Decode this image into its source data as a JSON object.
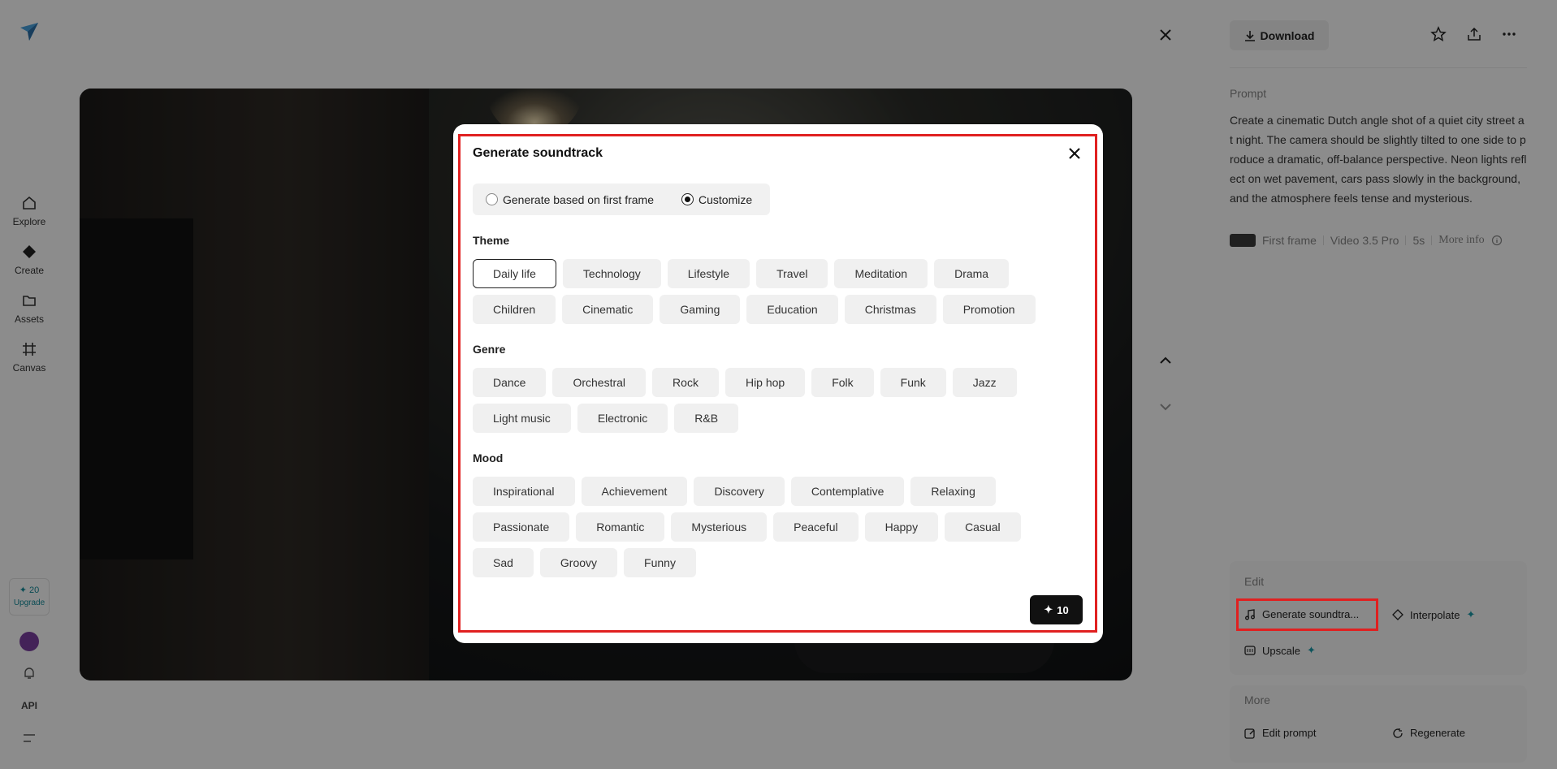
{
  "left_nav": {
    "items": [
      {
        "label": "Explore",
        "icon": "home-icon"
      },
      {
        "label": "Create",
        "icon": "diamond-icon"
      },
      {
        "label": "Assets",
        "icon": "folder-icon"
      },
      {
        "label": "Canvas",
        "icon": "canvas-icon"
      }
    ],
    "credits": "✦ 20",
    "upgrade_label": "Upgrade",
    "api_label": "API"
  },
  "right_panel": {
    "download_label": "Download",
    "prompt_label": "Prompt",
    "prompt_text": "Create a cinematic Dutch angle shot of a quiet city street at night. The camera should be slightly tilted to one side to produce a dramatic, off-balance perspective. Neon lights reflect on wet pavement, cars pass slowly in the background, and the atmosphere feels tense and mysterious.",
    "meta": {
      "first_frame": "First frame",
      "model": "Video 3.5 Pro",
      "duration": "5s",
      "more_info": "More info"
    },
    "edit_label": "Edit",
    "edit_actions": {
      "generate_soundtrack": "Generate soundtra...",
      "interpolate": "Interpolate",
      "upscale": "Upscale"
    },
    "more_label": "More",
    "more_actions": {
      "edit_prompt": "Edit prompt",
      "regenerate": "Regenerate"
    }
  },
  "modal": {
    "title": "Generate soundtrack",
    "modes": {
      "first_frame": "Generate based on first frame",
      "customize": "Customize",
      "selected": "Customize"
    },
    "theme_label": "Theme",
    "theme_row1": [
      "Daily life",
      "Technology",
      "Lifestyle",
      "Travel",
      "Meditation",
      "Drama"
    ],
    "theme_row2": [
      "Children",
      "Cinematic",
      "Gaming",
      "Education",
      "Christmas",
      "Promotion"
    ],
    "selected_theme": "Daily life",
    "genre_label": "Genre",
    "genre_row1": [
      "Dance",
      "Orchestral",
      "Rock",
      "Hip hop",
      "Folk",
      "Funk",
      "Jazz"
    ],
    "genre_row2": [
      "Light music",
      "Electronic",
      "R&B"
    ],
    "mood_label": "Mood",
    "mood_row1": [
      "Inspirational",
      "Achievement",
      "Discovery",
      "Contemplative",
      "Relaxing"
    ],
    "mood_row2": [
      "Passionate",
      "Romantic",
      "Mysterious",
      "Peaceful",
      "Happy",
      "Casual"
    ],
    "mood_row3": [
      "Sad",
      "Groovy",
      "Funny"
    ],
    "generate_cost": "10"
  },
  "colors": {
    "accent": "#1a9aa8",
    "highlight": "#e02020",
    "button_dark": "#111111"
  }
}
